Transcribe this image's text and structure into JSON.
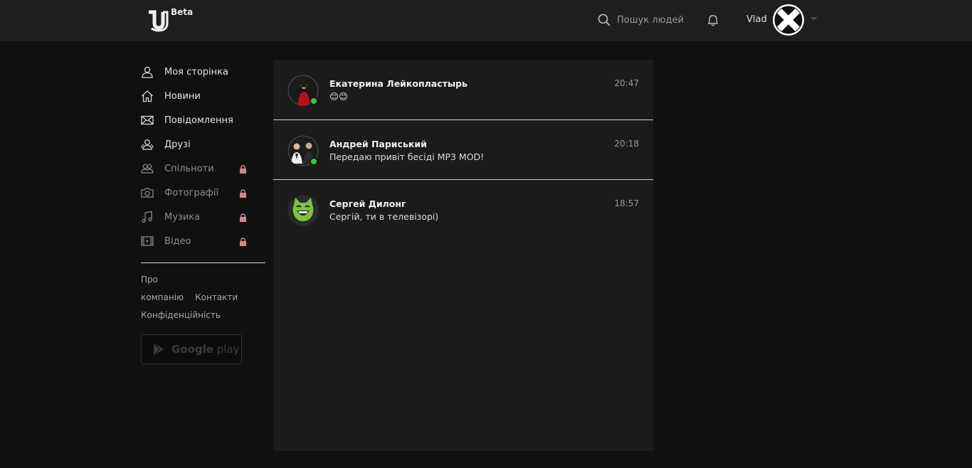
{
  "header": {
    "beta_label": "Beta",
    "search_placeholder": "Пошук людей",
    "username": "Vlad"
  },
  "sidebar": {
    "items": [
      {
        "label": "Моя сторінка",
        "icon": "user-icon",
        "locked": false
      },
      {
        "label": "Новини",
        "icon": "home-icon",
        "locked": false
      },
      {
        "label": "Повідомлення",
        "icon": "mail-icon",
        "locked": false
      },
      {
        "label": "Друзі",
        "icon": "friends-icon",
        "locked": false
      },
      {
        "label": "Спільноти",
        "icon": "communities-icon",
        "locked": true
      },
      {
        "label": "Фотографії",
        "icon": "camera-icon",
        "locked": true
      },
      {
        "label": "Музика",
        "icon": "music-icon",
        "locked": true
      },
      {
        "label": "Відео",
        "icon": "film-icon",
        "locked": true
      }
    ],
    "links": {
      "about": "Про компанію",
      "contacts": "Контакти",
      "privacy": "Конфіденційність"
    },
    "google_play": {
      "bold": "Google",
      "light": " play"
    }
  },
  "conversations": [
    {
      "name": "Екатерина Лейкопластырь",
      "time": "20:47",
      "message": "😊😊",
      "online": true
    },
    {
      "name": "Андрей Париський",
      "time": "20:18",
      "message": "Передаю привіт бесіді MP3 MOD!",
      "online": true
    },
    {
      "name": "Сергей Дилонг",
      "time": "18:57",
      "message": "Сергій, ти в телевізорі)",
      "online": false
    }
  ],
  "colors": {
    "background": "#101010",
    "topbar": "#1e1e1e",
    "panel": "#1b1b1b",
    "online": "#3fbf4a",
    "lock": "#c98a8a"
  }
}
